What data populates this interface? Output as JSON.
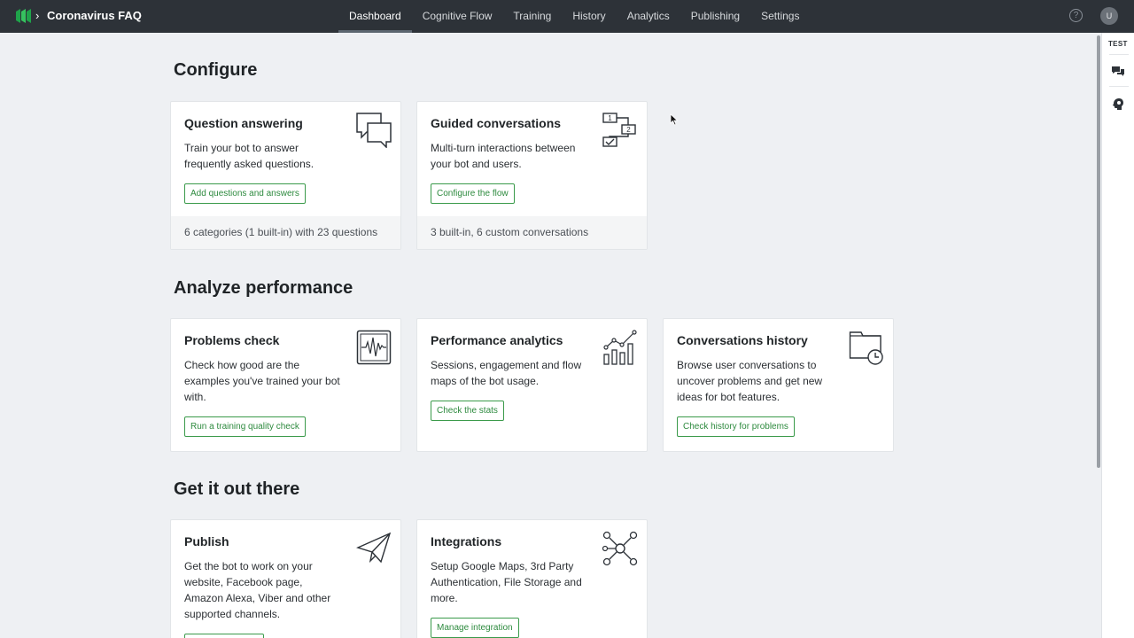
{
  "header": {
    "app_title": "Coronavirus FAQ",
    "nav": [
      {
        "label": "Dashboard",
        "active": true
      },
      {
        "label": "Cognitive Flow"
      },
      {
        "label": "Training"
      },
      {
        "label": "History"
      },
      {
        "label": "Analytics"
      },
      {
        "label": "Publishing"
      },
      {
        "label": "Settings"
      }
    ],
    "help": "?",
    "avatar": "U"
  },
  "right_panel": {
    "test_label": "TEST"
  },
  "sections": {
    "configure": "Configure",
    "analyze": "Analyze performance",
    "get_out": "Get it out there"
  },
  "cards": {
    "qa": {
      "title": "Question answering",
      "desc": "Train your bot to answer frequently asked questions.",
      "button": "Add questions and answers",
      "footer": "6 categories (1 built-in) with 23 questions"
    },
    "guided": {
      "title": "Guided conversations",
      "desc": "Multi-turn interactions between your bot and users.",
      "button": "Configure the flow",
      "footer": "3 built-in, 6 custom conversations",
      "icon_text_1": "1",
      "icon_text_2": "2"
    },
    "problems": {
      "title": "Problems check",
      "desc": "Check how good are the examples you've trained your bot with.",
      "button": "Run a training quality check"
    },
    "perf": {
      "title": "Performance analytics",
      "desc": "Sessions, engagement and flow maps of the bot usage.",
      "button": "Check the stats"
    },
    "history": {
      "title": "Conversations history",
      "desc": "Browse user conversations to uncover problems and get new ideas for bot features.",
      "button": "Check history for problems"
    },
    "publish": {
      "title": "Publish",
      "desc": "Get the bot to work on your website, Facebook page, Amazon Alexa, Viber and other supported channels."
    },
    "integrations": {
      "title": "Integrations",
      "desc": "Setup Google Maps, 3rd Party Authentication, File Storage and more.",
      "button": "Manage integration"
    }
  },
  "colors": {
    "accent_green": "#2d8a3e",
    "topbar": "#2d3238",
    "background": "#eef0f3"
  }
}
